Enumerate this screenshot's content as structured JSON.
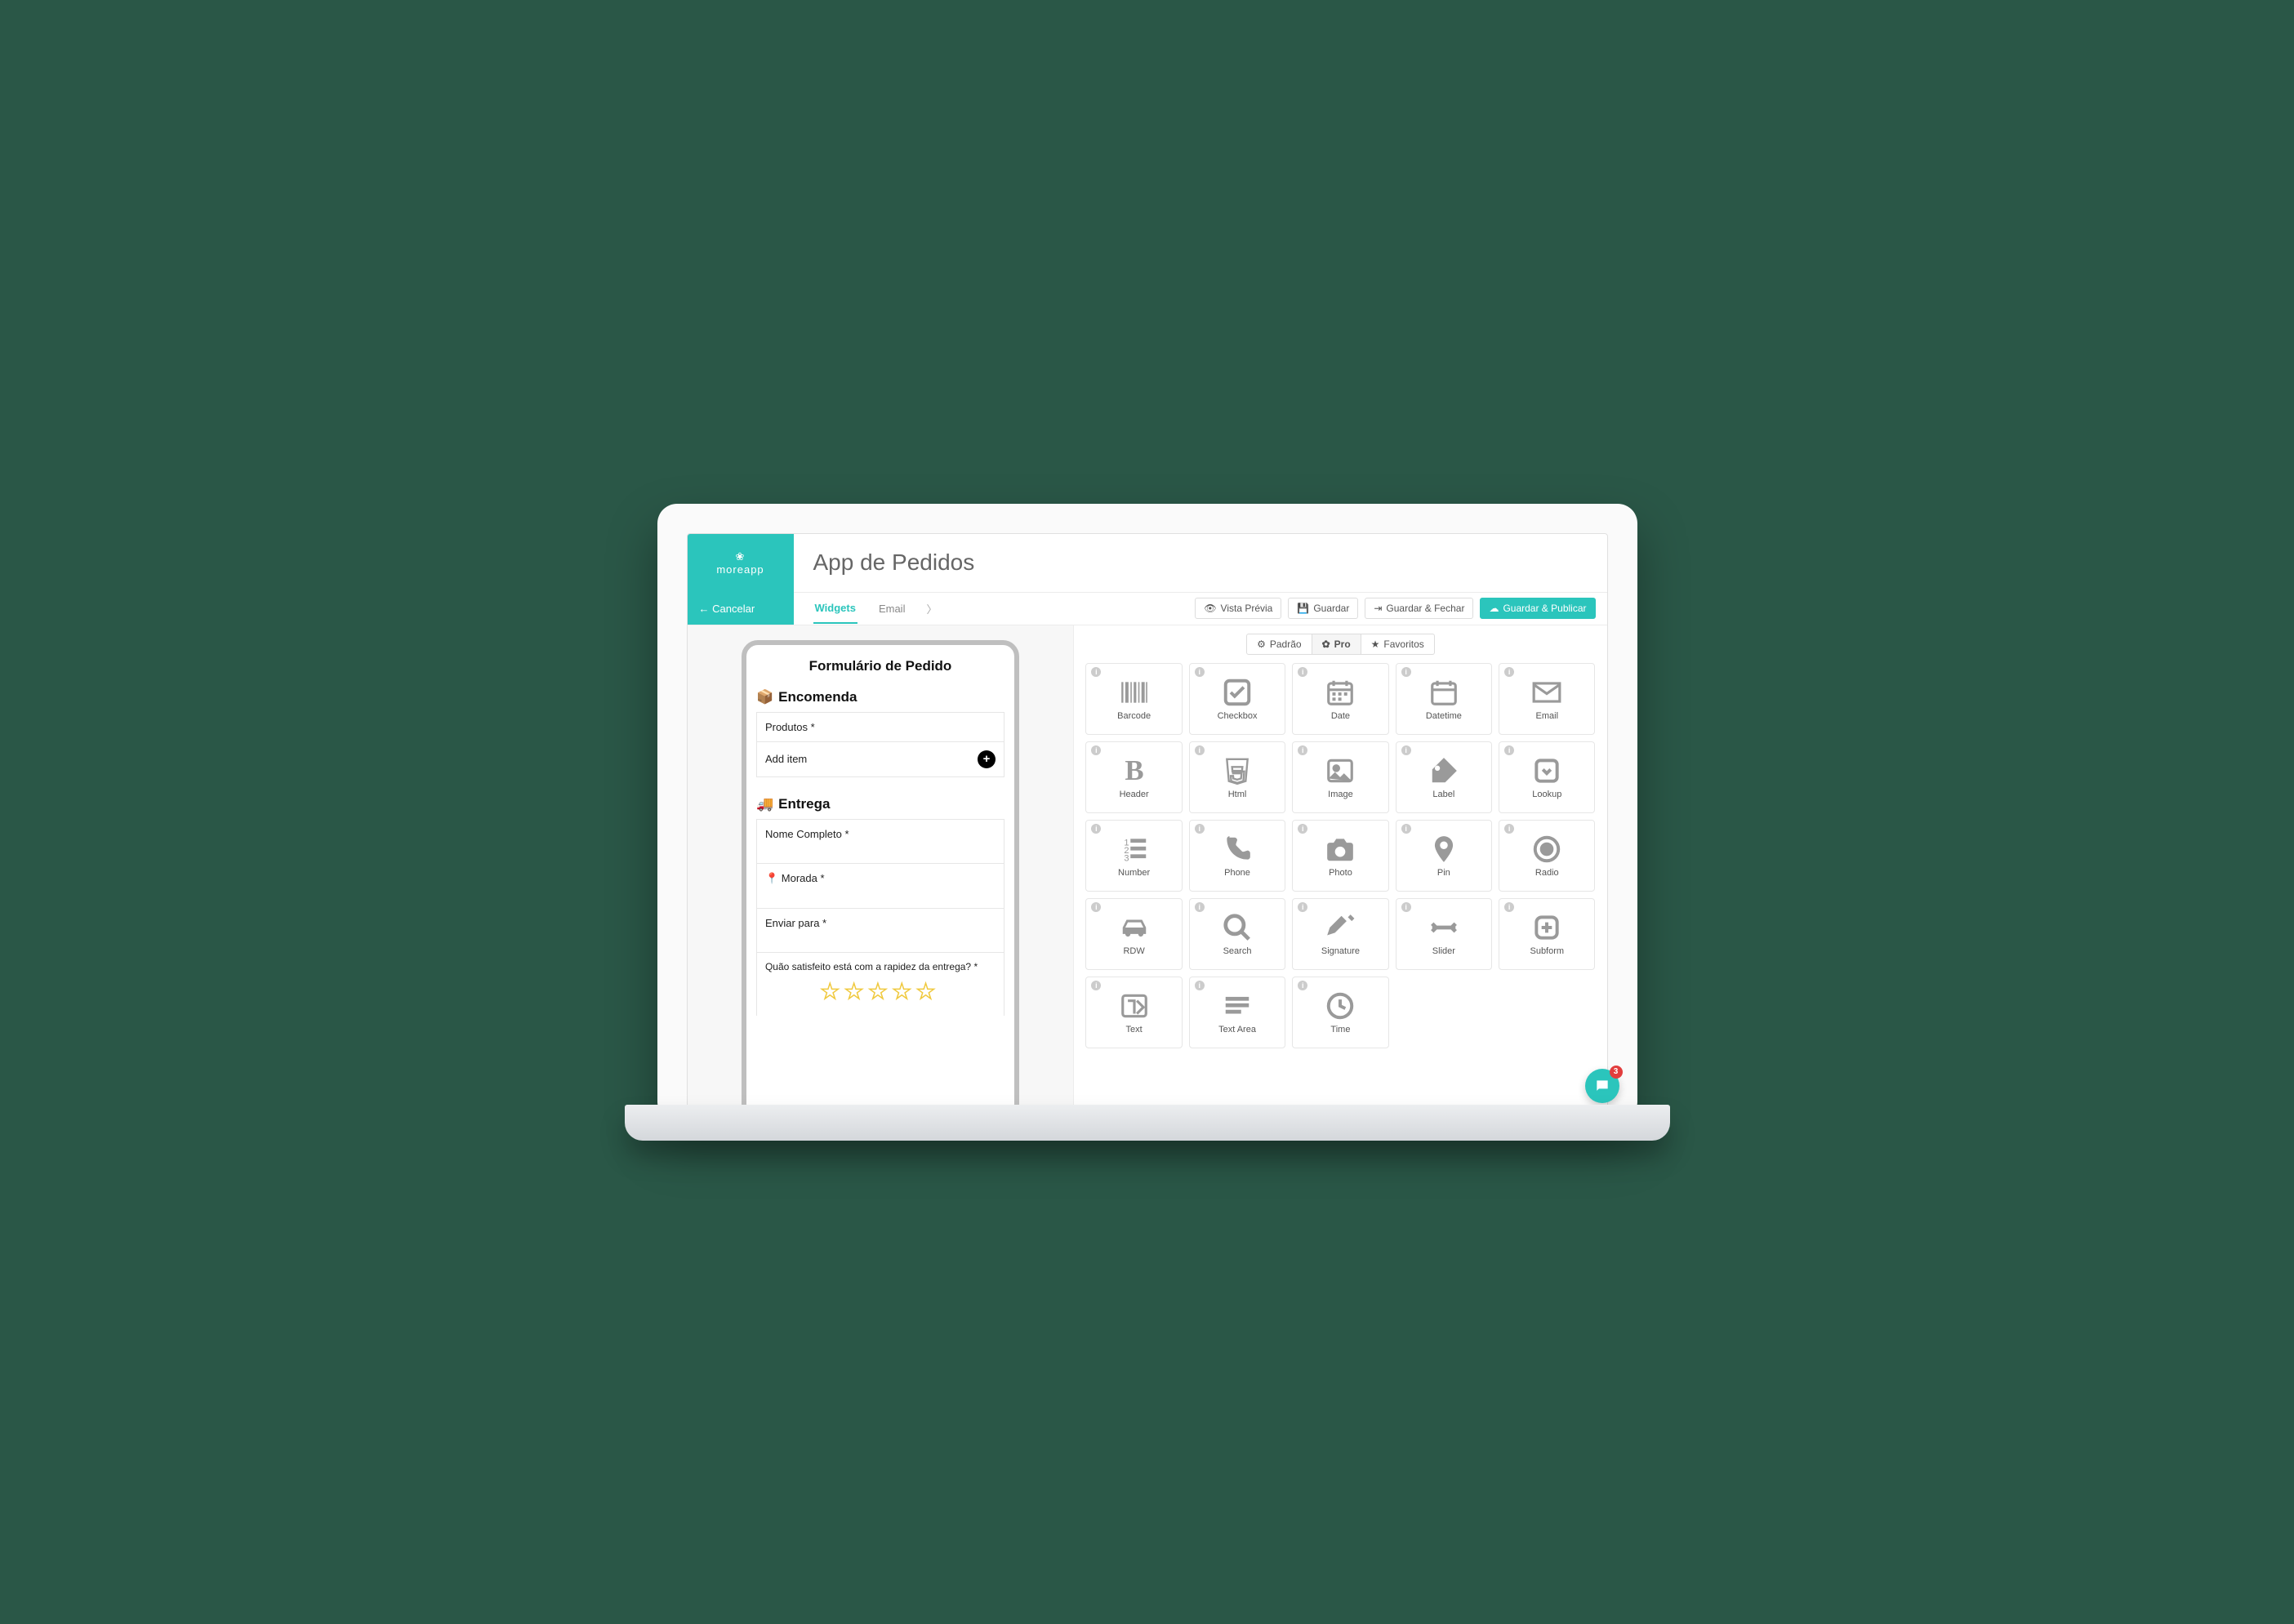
{
  "brand": "moreapp",
  "cancel": "Cancelar",
  "page_title": "App de Pedidos",
  "tabs": {
    "widgets": "Widgets",
    "email": "Email"
  },
  "actions": {
    "preview": "Vista Prévia",
    "save": "Guardar",
    "save_close": "Guardar & Fechar",
    "save_publish": "Guardar & Publicar"
  },
  "form": {
    "title": "Formulário de Pedido",
    "order_heading": "Encomenda",
    "products_label": "Produtos *",
    "add_item": "Add item",
    "delivery_heading": "Entrega",
    "fullname_label": "Nome Completo *",
    "address_label": "Morada *",
    "sendto_label": "Enviar para *",
    "rating_label": "Quão satisfeito está com a rapidez da entrega? *"
  },
  "categories": {
    "default": "Padrão",
    "pro": "Pro",
    "favorites": "Favoritos"
  },
  "widgets": [
    {
      "label": "Barcode",
      "icon": "barcode"
    },
    {
      "label": "Checkbox",
      "icon": "checkbox"
    },
    {
      "label": "Date",
      "icon": "date"
    },
    {
      "label": "Datetime",
      "icon": "datetime"
    },
    {
      "label": "Email",
      "icon": "email"
    },
    {
      "label": "Header",
      "icon": "header"
    },
    {
      "label": "Html",
      "icon": "html"
    },
    {
      "label": "Image",
      "icon": "image"
    },
    {
      "label": "Label",
      "icon": "label"
    },
    {
      "label": "Lookup",
      "icon": "lookup"
    },
    {
      "label": "Number",
      "icon": "number"
    },
    {
      "label": "Phone",
      "icon": "phone"
    },
    {
      "label": "Photo",
      "icon": "photo"
    },
    {
      "label": "Pin",
      "icon": "pin"
    },
    {
      "label": "Radio",
      "icon": "radio"
    },
    {
      "label": "RDW",
      "icon": "rdw"
    },
    {
      "label": "Search",
      "icon": "search"
    },
    {
      "label": "Signature",
      "icon": "signature"
    },
    {
      "label": "Slider",
      "icon": "slider"
    },
    {
      "label": "Subform",
      "icon": "subform"
    },
    {
      "label": "Text",
      "icon": "text"
    },
    {
      "label": "Text Area",
      "icon": "textarea"
    },
    {
      "label": "Time",
      "icon": "time"
    }
  ],
  "chat_badge": "3"
}
